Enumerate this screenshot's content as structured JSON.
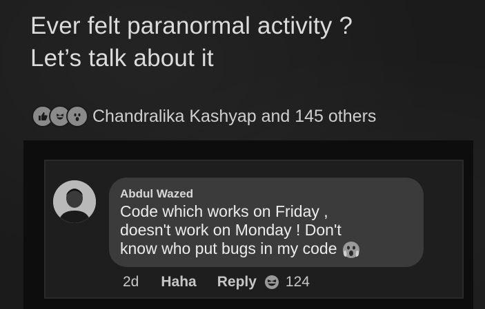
{
  "post": {
    "title_line1": "Ever felt paranormal activity ?",
    "title_line2": "Let’s talk about it"
  },
  "reactions": {
    "icons": [
      "like-icon",
      "haha-icon",
      "wow-icon"
    ],
    "text": "Chandralika Kashyap and 145 others"
  },
  "comment": {
    "author": "Abdul Wazed",
    "lines": [
      "Code which works on Friday ,",
      "doesn't work on Monday ! Don't",
      "know who put bugs in my code"
    ],
    "trailing_emoji": "scream-icon",
    "time": "2d",
    "haha_label": "Haha",
    "reply_label": "Reply",
    "reaction_icon": "haha-icon",
    "reaction_count": "124"
  },
  "colors": {
    "background": "#1b1b1b",
    "bubble": "#3b3b3b",
    "text": "#e6e6e6"
  }
}
